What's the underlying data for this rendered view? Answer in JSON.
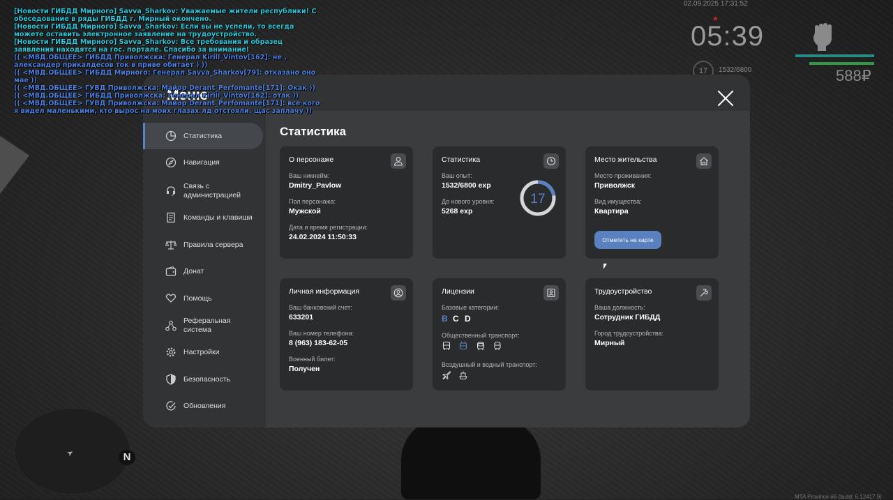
{
  "chat": [
    {
      "kind": "news",
      "text": "[Новости ГИБДД Мирного] Savva_Sharkov: Уважаемые жители республики! С обеседование в ряды ГИБДД г. Мирный окончено."
    },
    {
      "kind": "news",
      "text": "[Новости ГИБДД Мирного] Savva_Sharkov: Если вы не успели, то всегда можете оставить электронное заявление на трудоустройство."
    },
    {
      "kind": "news",
      "text": "[Новости ГИБДД Мирного] Savva_Sharkov: Все требования и образец заявления находятся на гос. портале. Спасибо за внимание!"
    },
    {
      "kind": "mvd",
      "text": "(( <МВД.ОБЩЕЕ> ГИБДД Приволжска: Генерал Kirill_Vintov[162]: не , александер прикалдесов ток в приве обитает ) ))"
    },
    {
      "kind": "mvd",
      "text": "(( <МВД.ОБЩЕЕ> ГИБДД Мирного: Генерал Savva_Sharkov[79]: отказано оно мае ))"
    },
    {
      "kind": "mvd",
      "text": "(( <МВД.ОБЩЕЕ> ГУВД Приволжска: Майор Derant_Perfomante[171]: Окак ))"
    },
    {
      "kind": "mvd",
      "text": "(( <МВД.ОБЩЕЕ> ГИБДД Приволжска: Генерал Kirill_Vintov[162]: отак ))"
    },
    {
      "kind": "mvd",
      "text": "(( <МВД.ОБЩЕЕ> ГУВД Приволжска: Майор Derant_Perfomante[171]: все кого я видел маленькими, кто вырос на моих глазах лд отстояли, щас заплачу ))"
    }
  ],
  "hud": {
    "date": "02.09.2025 17:31:52",
    "time": "05:39",
    "wanted": "★",
    "level": "17",
    "exp": "1532/6800",
    "money": "588₽",
    "build": "MTA Province #6 (build: 6.12417.9)",
    "minimap_north": "N",
    "player_arrow": "➤"
  },
  "menu": {
    "title": "Меню",
    "section_title": "Статистика",
    "accent": "#5b82c4",
    "nav": [
      {
        "label": "Статистика",
        "icon": "pie-chart-icon",
        "active": true
      },
      {
        "label": "Навигация",
        "icon": "compass-icon"
      },
      {
        "label": "Связь с администрацией",
        "icon": "headset-icon"
      },
      {
        "label": "Команды и клавиши",
        "icon": "document-icon"
      },
      {
        "label": "Правила сервера",
        "icon": "scales-icon"
      },
      {
        "label": "Донат",
        "icon": "wallet-icon"
      },
      {
        "label": "Помощь",
        "icon": "heart-hands-icon"
      },
      {
        "label": "Реферальная система",
        "icon": "network-icon"
      },
      {
        "label": "Настройки",
        "icon": "gear-icon"
      },
      {
        "label": "Безопасность",
        "icon": "shield-icon"
      },
      {
        "label": "Обновления",
        "icon": "check-circle-icon"
      }
    ],
    "cards": {
      "character": {
        "title": "О персонаже",
        "nick_label": "Ваш никнейм:",
        "nick": "Dmitry_Pavlow",
        "gender_label": "Пол персонажа:",
        "gender": "Мужской",
        "reg_label": "Дата и время регистрации:",
        "reg": "24.02.2024 11:50:33"
      },
      "stats": {
        "title": "Статистика",
        "exp_label": "Ваш опыт:",
        "exp": "1532/6800 exp",
        "next_label": "До нового уровня:",
        "next": "5268 exp",
        "level": "17",
        "progress": 0.2253
      },
      "residence": {
        "title": "Место жительства",
        "place_label": "Место проживания:",
        "place": "Приволжск",
        "property_label": "Вид имущества:",
        "property": "Квартира",
        "button": "Отметить на карте"
      },
      "personal": {
        "title": "Личная информация",
        "bank_label": "Ваш банковский счет:",
        "bank": "633201",
        "phone_label": "Ваш номер телефона:",
        "phone": "8 (963) 183-62-05",
        "military_label": "Военный билет:",
        "military": "Получен"
      },
      "licenses": {
        "title": "Лицензии",
        "basic_label": "Базовые категории:",
        "categories": [
          {
            "name": "B",
            "color": "#5b82c4"
          },
          {
            "name": "C",
            "color": "#ffffff"
          },
          {
            "name": "D",
            "color": "#ffffff"
          }
        ],
        "public_label": "Общественный транспорт:",
        "air_label": "Воздушный и водный транспорт:"
      },
      "job": {
        "title": "Трудоустройство",
        "position_label": "Ваша должность:",
        "position": "Сотрудник ГИБДД",
        "city_label": "Город трудоустройства:",
        "city": "Мирный"
      }
    }
  }
}
